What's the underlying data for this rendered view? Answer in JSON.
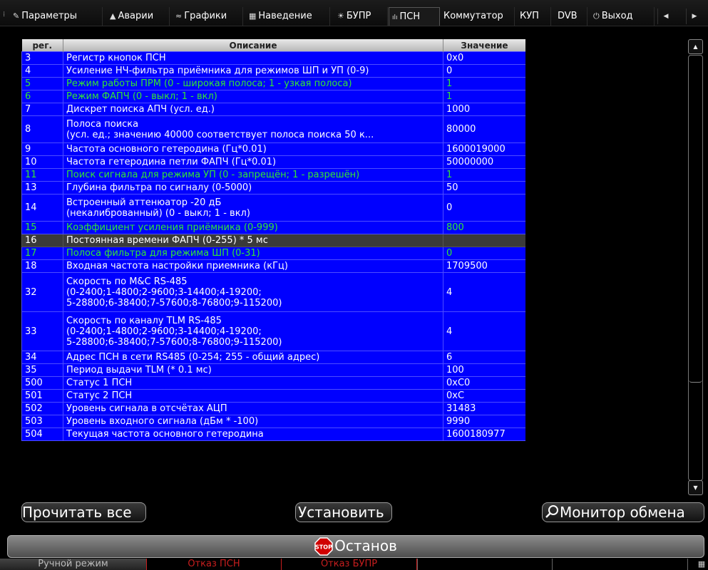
{
  "tabs": [
    {
      "label": "Параметры",
      "icon": "gear-icon",
      "glyph": "✎"
    },
    {
      "label": "Аварии",
      "icon": "warning-icon",
      "glyph": "▲"
    },
    {
      "label": "Графики",
      "icon": "chart-icon",
      "glyph": "≈"
    },
    {
      "label": "Наведение",
      "icon": "target-icon",
      "glyph": "▦"
    },
    {
      "label": "БУПР",
      "icon": "antenna-icon",
      "glyph": "☀"
    },
    {
      "label": "ПСН",
      "icon": "signal-icon",
      "glyph": "ılı"
    },
    {
      "label": "Коммутатор",
      "icon": "",
      "glyph": ""
    },
    {
      "label": "КУП",
      "icon": "",
      "glyph": ""
    },
    {
      "label": "DVB",
      "icon": "",
      "glyph": ""
    },
    {
      "label": "Выход",
      "icon": "power-icon",
      "glyph": "⏻"
    }
  ],
  "table": {
    "headers": [
      "рег.",
      "Описание",
      "Значение"
    ],
    "rows": [
      {
        "reg": "3",
        "desc": [
          "Регистр кнопок ПСН"
        ],
        "value": "0x0",
        "readonly": false
      },
      {
        "reg": "4",
        "desc": [
          "Усиление НЧ-фильтра приёмника для режимов ШП и УП (0-9)"
        ],
        "value": "0",
        "readonly": false
      },
      {
        "reg": "5",
        "desc": [
          "Режим работы ПРМ (0 - широкая полоса; 1 - узкая полоса)"
        ],
        "value": "1",
        "readonly": true
      },
      {
        "reg": "6",
        "desc": [
          "Режим ФАПЧ (0 - выкл; 1 - вкл)"
        ],
        "value": "1",
        "readonly": true
      },
      {
        "reg": "7",
        "desc": [
          "Дискрет поиска АПЧ (усл. ед.)"
        ],
        "value": "1000",
        "readonly": false
      },
      {
        "reg": "8",
        "desc": [
          "Полоса поиска",
          "(усл. ед.; значению 40000 соответствует полоса поиска 50 к..."
        ],
        "value": "80000",
        "readonly": false
      },
      {
        "reg": "9",
        "desc": [
          "Частота основного гетеродина (Гц*0.01)"
        ],
        "value": "1600019000",
        "readonly": false
      },
      {
        "reg": "10",
        "desc": [
          "Частота гетеродина петли ФАПЧ (Гц*0.01)"
        ],
        "value": "50000000",
        "readonly": false
      },
      {
        "reg": "11",
        "desc": [
          "Поиск сигнала для режима УП (0 - запрещён; 1 - разрешён)"
        ],
        "value": "1",
        "readonly": true
      },
      {
        "reg": "13",
        "desc": [
          "Глубина фильтра по сигналу (0-5000)"
        ],
        "value": "50",
        "readonly": false
      },
      {
        "reg": "14",
        "desc": [
          "Встроенный аттенюатор -20 дБ",
          "(некалиброванный) (0 - выкл; 1 - вкл)"
        ],
        "value": "0",
        "readonly": false
      },
      {
        "reg": "15",
        "desc": [
          "Коэффициент усиления приёмника (0-999)"
        ],
        "value": "800",
        "readonly": true
      },
      {
        "reg": "16",
        "desc": [
          "Постоянная времени ФАПЧ (0-255) * 5 мс"
        ],
        "value": "",
        "readonly": false,
        "selected": true
      },
      {
        "reg": "17",
        "desc": [
          "Полоса фильтра для режима ШП (0-31)"
        ],
        "value": "0",
        "readonly": true
      },
      {
        "reg": "18",
        "desc": [
          "Входная частота настройки приемника (кГц)"
        ],
        "value": "1709500",
        "readonly": false
      },
      {
        "reg": "32",
        "desc": [
          "Скорость по M&C RS-485",
          "(0-2400;1-4800;2-9600;3-14400;4-19200;",
          "5-28800;6-38400;7-57600;8-76800;9-115200)"
        ],
        "value": "4",
        "readonly": false
      },
      {
        "reg": "33",
        "desc": [
          "Скорость по каналу TLM RS-485",
          "(0-2400;1-4800;2-9600;3-14400;4-19200;",
          "5-28800;6-38400;7-57600;8-76800;9-115200)"
        ],
        "value": "4",
        "readonly": false
      },
      {
        "reg": "34",
        "desc": [
          "Адрес ПСН в сети RS485 (0-254; 255 - общий адрес)"
        ],
        "value": "6",
        "readonly": false
      },
      {
        "reg": "35",
        "desc": [
          "Период выдачи TLM (* 0.1 мс)"
        ],
        "value": "100",
        "readonly": false
      },
      {
        "reg": "500",
        "desc": [
          "Статус 1 ПСН"
        ],
        "value": "0xC0",
        "readonly": false
      },
      {
        "reg": "501",
        "desc": [
          "Статус 2 ПСН"
        ],
        "value": "0xC",
        "readonly": false
      },
      {
        "reg": "502",
        "desc": [
          "Уровень сигнала в отсчётах АЦП"
        ],
        "value": "31483",
        "readonly": false
      },
      {
        "reg": "503",
        "desc": [
          "Уровень входного сигнала (дБм * -100)"
        ],
        "value": "9990",
        "readonly": false
      },
      {
        "reg": "504",
        "desc": [
          "Текущая частота основного гетеродина"
        ],
        "value": "1600180977",
        "readonly": false
      }
    ]
  },
  "buttons": {
    "read_all": "Прочитать все",
    "set": "Установить",
    "monitor": "Монитор обмена"
  },
  "stop": {
    "label": "Останов",
    "icon_text": "STOP"
  },
  "status": {
    "manual": "Ручной режим",
    "fault_psn": "Отказ ПСН",
    "fault_bupr": "Отказ БУПР"
  },
  "colors": {
    "row_bg": "#0000ff",
    "readonly_text": "#33e533",
    "selected_bg": "#3a3a3a",
    "fault_text": "#c81e1e"
  }
}
